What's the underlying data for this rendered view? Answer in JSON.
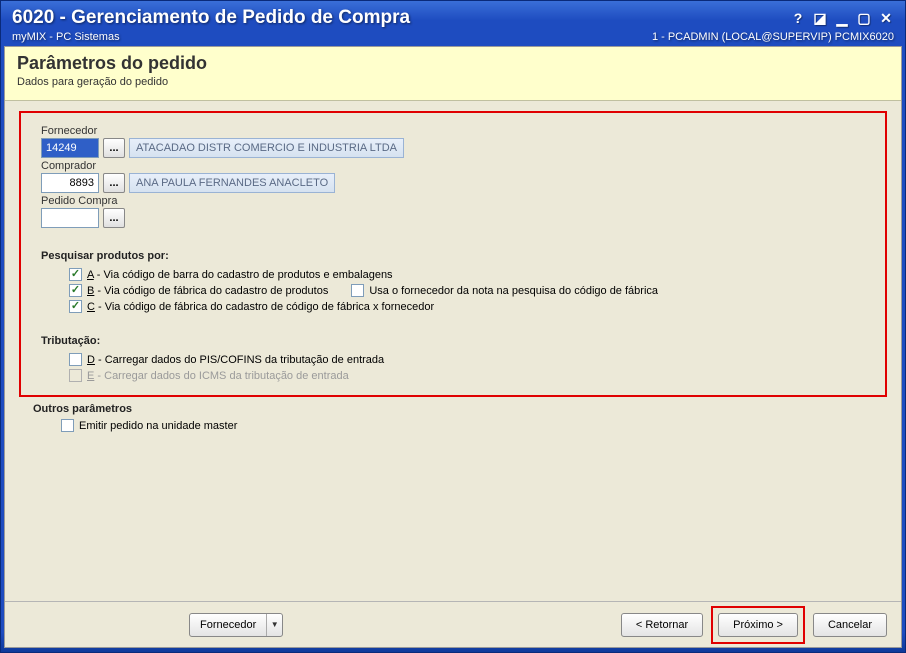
{
  "window": {
    "title": "6020 - Gerenciamento de Pedido de Compra",
    "subtitle_left": "myMIX - PC Sistemas",
    "subtitle_right": "1 - PCADMIN (LOCAL@SUPERVIP)   PCMIX6020"
  },
  "banner": {
    "title": "Parâmetros do pedido",
    "subtitle": "Dados para geração do pedido"
  },
  "fields": {
    "fornecedor": {
      "label": "Fornecedor",
      "code": "14249",
      "name": "ATACADAO DISTR COMERCIO E INDUSTRIA LTDA"
    },
    "comprador": {
      "label": "Comprador",
      "code": "8893",
      "name": "ANA PAULA FERNANDES ANACLETO"
    },
    "pedido": {
      "label": "Pedido Compra",
      "code": ""
    }
  },
  "lookup_glyph": "...",
  "pesquisar": {
    "title": "Pesquisar produtos por:",
    "a": {
      "letter": "A",
      "text": " - Via código de barra do cadastro de produtos e embalagens",
      "checked": true
    },
    "b": {
      "letter": "B",
      "text": " - Via código de fábrica do cadastro de produtos",
      "checked": true,
      "sub": {
        "text": "Usa o fornecedor da nota na pesquisa do código de fábrica",
        "checked": false
      }
    },
    "c": {
      "letter": "C",
      "text": " - Via código de fábrica do cadastro de código de fábrica x fornecedor",
      "checked": true
    }
  },
  "tributacao": {
    "title": "Tributação:",
    "d": {
      "letter": "D",
      "text": " - Carregar dados do PIS/COFINS da tributação de entrada",
      "checked": false
    },
    "e": {
      "letter": "E",
      "text": " - Carregar dados do ICMS da tributação de entrada",
      "checked": false,
      "disabled": true
    }
  },
  "outros": {
    "title": "Outros parâmetros",
    "emitir": {
      "text": "Emitir pedido na unidade master",
      "checked": false
    }
  },
  "footer": {
    "fornecedor_btn": "Fornecedor",
    "retornar": "< Retornar",
    "proximo": "Próximo >",
    "cancelar": "Cancelar"
  }
}
